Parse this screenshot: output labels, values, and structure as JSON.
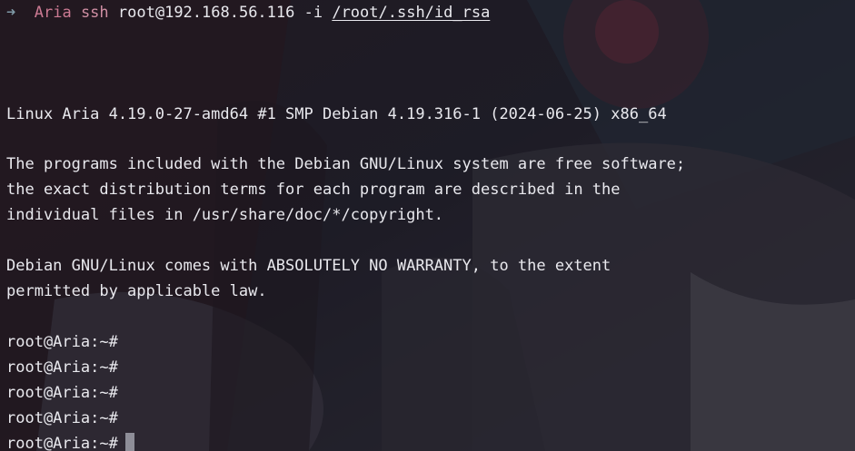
{
  "prompt": {
    "arrow": "➜",
    "hostname": "Aria",
    "command": "ssh",
    "args": "root@192.168.56.116 -i",
    "path": "/root/.ssh/id_rsa"
  },
  "motd": {
    "kernel": "Linux Aria 4.19.0-27-amd64 #1 SMP Debian 4.19.316-1 (2024-06-25) x86_64",
    "license_1": "The programs included with the Debian GNU/Linux system are free software;",
    "license_2": "the exact distribution terms for each program are described in the",
    "license_3": "individual files in /usr/share/doc/*/copyright.",
    "warranty_1": "Debian GNU/Linux comes with ABSOLUTELY NO WARRANTY, to the extent",
    "warranty_2": "permitted by applicable law."
  },
  "shell_prompts": [
    "root@Aria:~#",
    "root@Aria:~#",
    "root@Aria:~#",
    "root@Aria:~#",
    "root@Aria:~#"
  ],
  "colors": {
    "text": "#e9e9ee",
    "arrow": "#7f99a6",
    "accent": "#cc7a93",
    "cursor": "#8e8e98",
    "background": "#1b1a22"
  }
}
